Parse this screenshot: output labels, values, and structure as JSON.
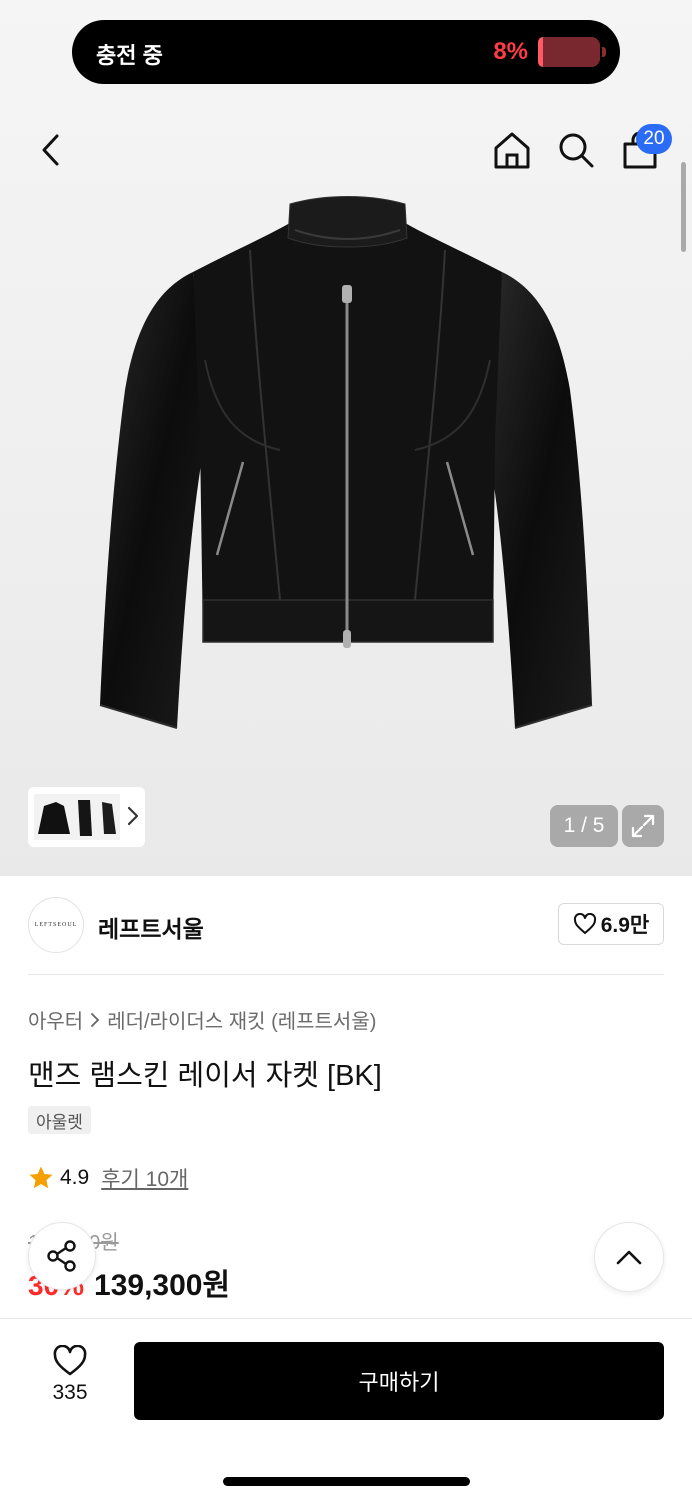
{
  "status": {
    "charging_label": "충전 중",
    "battery_percent": "8%",
    "battery_level": 0.08
  },
  "header": {
    "back_icon": "chevron-left-icon",
    "home_icon": "home-icon",
    "search_icon": "search-icon",
    "cart_icon": "shopping-bag-icon",
    "cart_count": "20"
  },
  "gallery": {
    "counter": "1 / 5",
    "expand_icon": "expand-icon"
  },
  "brand": {
    "logo_text": "LEFTSEOUL",
    "name": "레프트서울",
    "likes": "6.9만"
  },
  "product": {
    "breadcrumb": [
      "아우터",
      "레더/라이더스 재킷 (레프트서울)"
    ],
    "title": "맨즈 램스킨 레이서 자켓 [BK]",
    "tag": "아울렛",
    "rating": "4.9",
    "review_link": "후기 10개",
    "original_price": "199,000원",
    "discount": "30%",
    "sale_price": "139,300원"
  },
  "actions": {
    "share_icon": "share-icon",
    "scroll_top_icon": "chevron-up-icon",
    "wish_count": "335",
    "buy_label": "구매하기"
  },
  "colors": {
    "accent": "#2b6cf6",
    "discount": "#ff2b2b",
    "battery_low": "#ff3b46",
    "star": "#f5a000"
  }
}
